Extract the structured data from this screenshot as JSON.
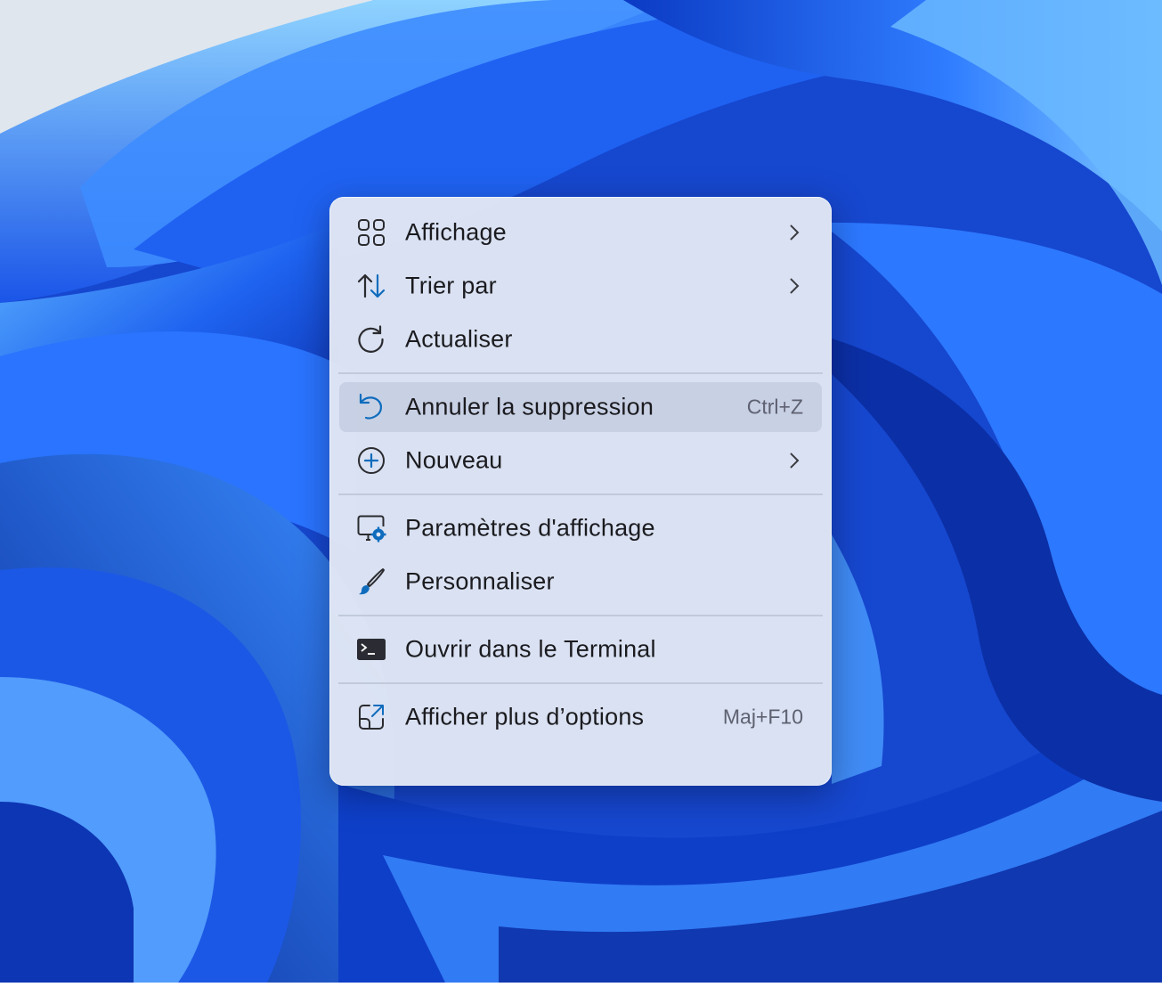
{
  "menu": {
    "items": [
      {
        "label": "Affichage",
        "icon": "grid-view-icon"
      },
      {
        "label": "Trier par",
        "icon": "sort-arrows-icon"
      },
      {
        "label": "Actualiser",
        "icon": "refresh-icon"
      },
      {
        "label": "Annuler la suppression",
        "icon": "undo-icon",
        "shortcut": "Ctrl+Z"
      },
      {
        "label": "Nouveau",
        "icon": "plus-circle-icon"
      },
      {
        "label": "Paramètres d'affichage",
        "icon": "display-settings-icon"
      },
      {
        "label": "Personnaliser",
        "icon": "brush-icon"
      },
      {
        "label": "Ouvrir dans le Terminal",
        "icon": "terminal-icon"
      },
      {
        "label": "Afficher plus d’options",
        "icon": "open-external-icon",
        "shortcut": "Maj+F10"
      }
    ]
  },
  "colors": {
    "accent": "#0f6cbd",
    "wallpaper_blue": "#1a4fd6",
    "menu_background": "#e2e7f4"
  }
}
